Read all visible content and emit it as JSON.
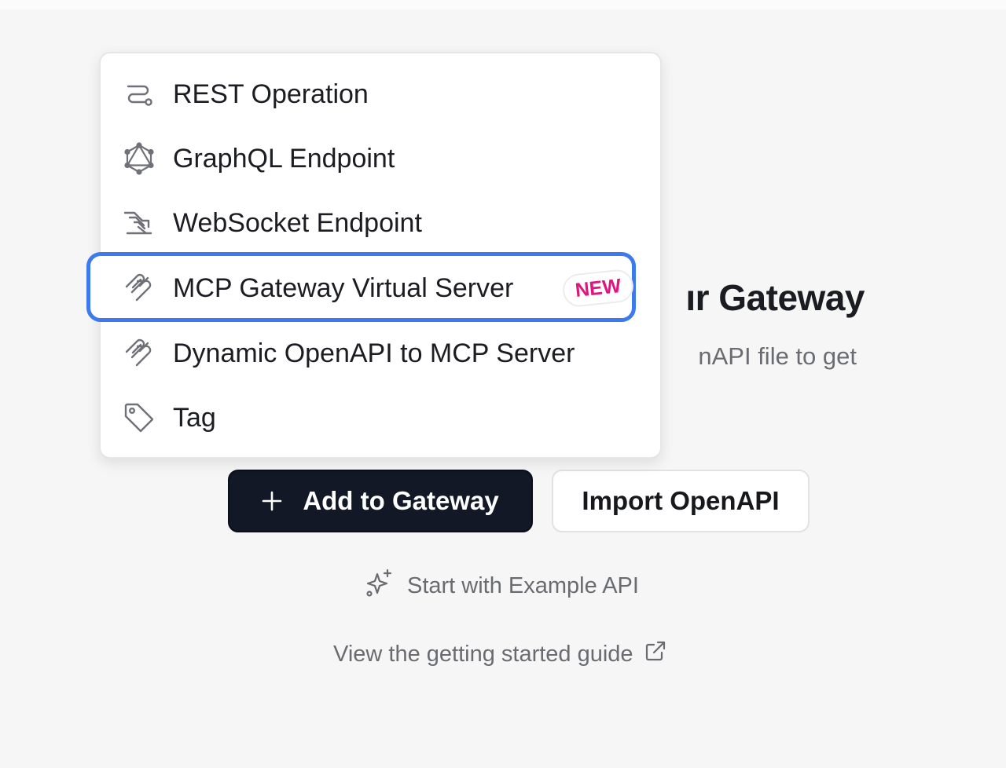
{
  "empty_state": {
    "title_partial": "ır Gateway",
    "subtitle_partial": "nAPI file to get"
  },
  "buttons": {
    "add_to_gateway": "Add to Gateway",
    "import_openapi": "Import OpenAPI"
  },
  "links": {
    "example_api": "Start with Example API",
    "getting_started": "View the getting started guide"
  },
  "dropdown": {
    "items": [
      {
        "label": "REST Operation",
        "icon": "rest-route-icon"
      },
      {
        "label": "GraphQL Endpoint",
        "icon": "graphql-icon"
      },
      {
        "label": "WebSocket Endpoint",
        "icon": "websocket-icon"
      },
      {
        "label": "MCP Gateway Virtual Server",
        "icon": "mcp-icon",
        "badge": "NEW",
        "highlighted": true
      },
      {
        "label": "Dynamic OpenAPI to MCP Server",
        "icon": "mcp-icon"
      },
      {
        "label": "Tag",
        "icon": "tag-icon"
      }
    ]
  },
  "colors": {
    "primary_button": "#121826",
    "highlight_border": "#3d79ef",
    "badge_text": "#e0157e",
    "background": "#f6f6f6"
  }
}
